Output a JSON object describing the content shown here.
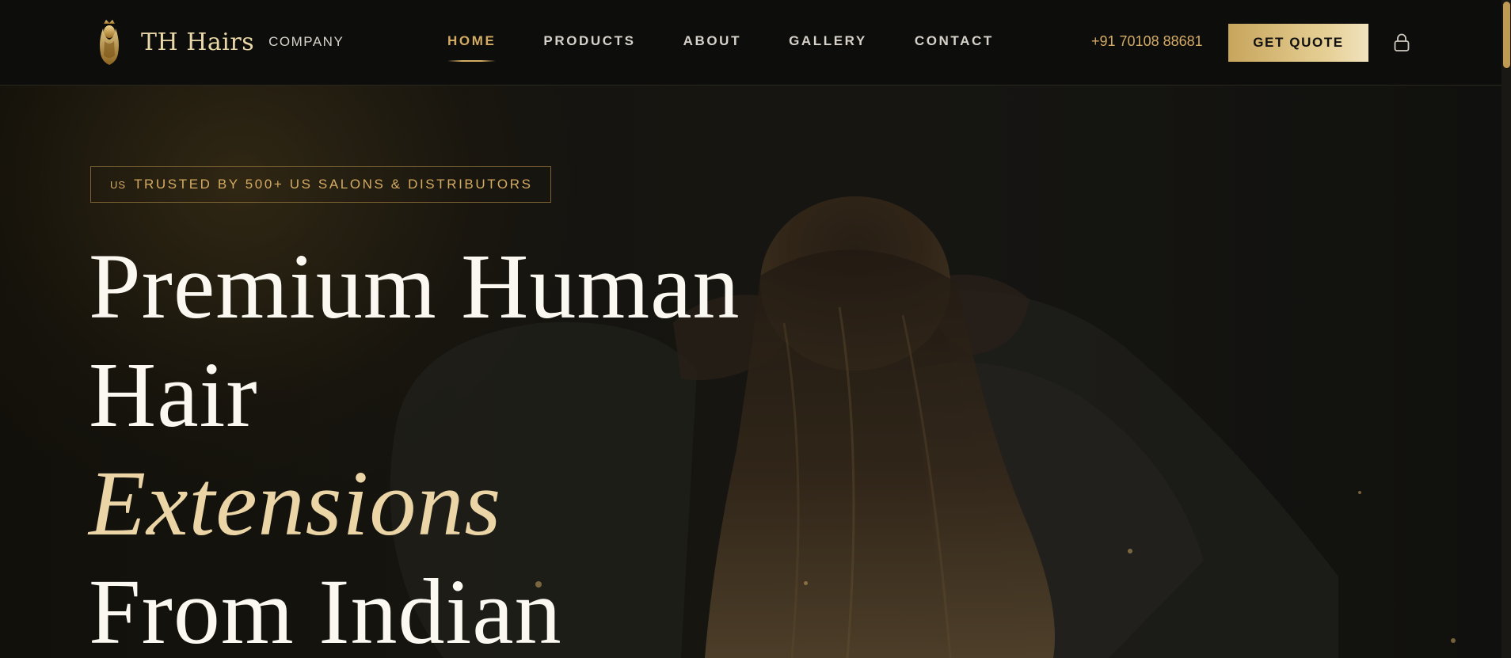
{
  "header": {
    "brand_name": "TH Hairs",
    "brand_sub": "COMPANY",
    "nav": [
      {
        "label": "HOME",
        "active": true
      },
      {
        "label": "PRODUCTS",
        "active": false
      },
      {
        "label": "ABOUT",
        "active": false
      },
      {
        "label": "GALLERY",
        "active": false
      },
      {
        "label": "CONTACT",
        "active": false
      }
    ],
    "phone": "+91 70108 88681",
    "quote_label": "GET QUOTE",
    "lock_icon": "lock-icon"
  },
  "hero": {
    "badge_flag": "US",
    "badge_text": "TRUSTED BY 500+ US SALONS & DISTRIBUTORS",
    "headline": [
      "Premium Human",
      "Hair",
      "Extensions",
      "From Indian"
    ]
  },
  "colors": {
    "accent_gold": "#d4ab63",
    "background": "#0b0b0b",
    "headline_white": "#fbf8f1",
    "headline_gold": "#ebd5a6"
  }
}
